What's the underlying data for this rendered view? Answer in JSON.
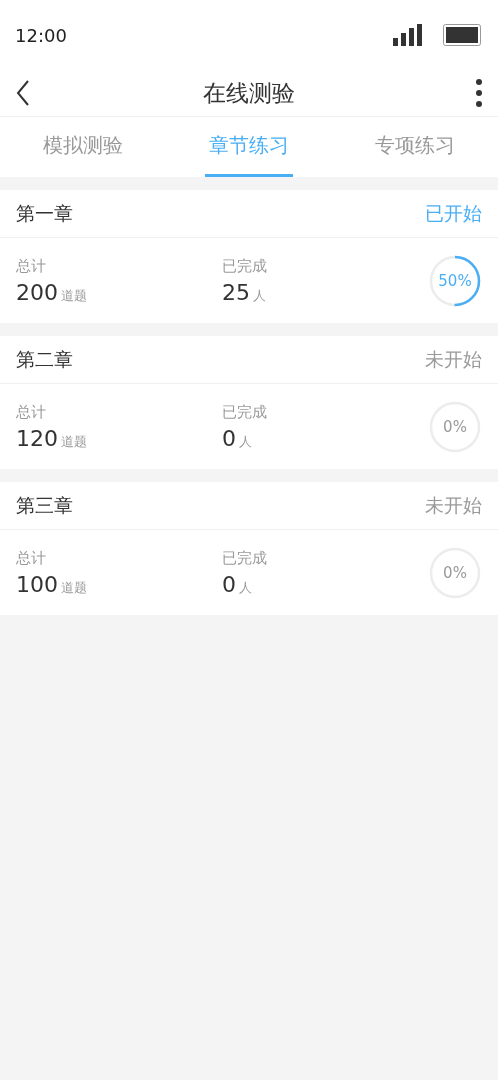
{
  "status_bar": {
    "time": "12:00"
  },
  "nav": {
    "title": "在线测验"
  },
  "tabs": [
    {
      "label": "模拟测验",
      "selected": false
    },
    {
      "label": "章节练习",
      "selected": true
    },
    {
      "label": "专项练习",
      "selected": false
    }
  ],
  "chapters": [
    {
      "title": "第一章",
      "status": "已开始",
      "started": true,
      "total_label": "总计",
      "total": "200",
      "total_unit": "道题",
      "done_label": "已完成",
      "done": "25",
      "done_unit": "人",
      "percent": "50%"
    },
    {
      "title": "第二章",
      "status": "未开始",
      "started": false,
      "total_label": "总计",
      "total": "120",
      "total_unit": "道题",
      "done_label": "已完成",
      "done": "0",
      "done_unit": "人",
      "percent": "0%"
    },
    {
      "title": "第三章",
      "status": "未开始",
      "started": false,
      "total_label": "总计",
      "total": "100",
      "total_unit": "道题",
      "done_label": "已完成",
      "done": "0",
      "done_unit": "人",
      "percent": "0%"
    }
  ]
}
